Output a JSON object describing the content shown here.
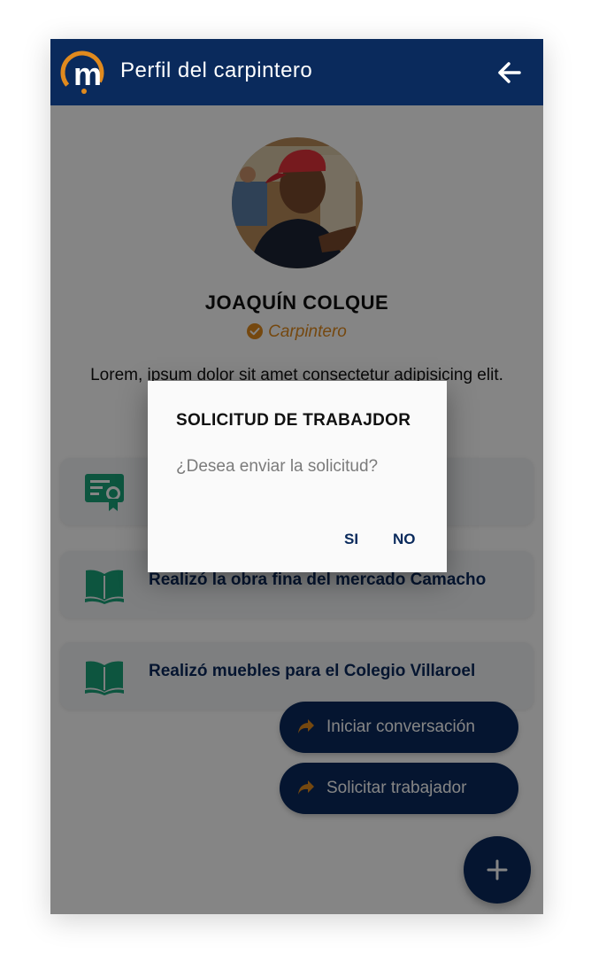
{
  "appbar": {
    "title": "Perfil del carpintero",
    "logo_icon": "m-logo-icon",
    "back_icon": "arrow-left-icon"
  },
  "profile": {
    "name": "JOAQUÍN COLQUE",
    "profession": "Carpintero",
    "description": "Lorem, ipsum dolor sit amet consectetur adipisicing elit. Saepe a... veniam"
  },
  "cards": [
    {
      "icon": "certificate-icon",
      "text": ""
    },
    {
      "icon": "book-icon",
      "text": "Realizó la obra fina del mercado Camacho"
    },
    {
      "icon": "book-icon",
      "text": "Realizó muebles para el Colegio Villaroel"
    }
  ],
  "actions": {
    "start_chat": "Iniciar conversación",
    "request_worker": "Solicitar trabajador"
  },
  "dialog": {
    "title": "SOLICITUD DE TRABAJDOR",
    "message": "¿Desea enviar la solicitud?",
    "yes": "SI",
    "no": "NO"
  },
  "colors": {
    "primary": "#0a2a5c",
    "accent": "#e08a1e",
    "icon_green": "#1aa37a"
  }
}
